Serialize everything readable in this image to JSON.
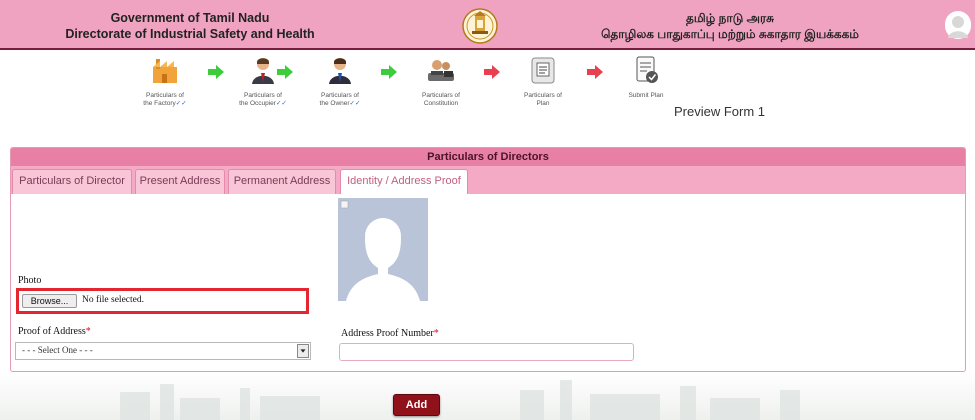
{
  "header": {
    "left_line1": "Government of Tamil Nadu",
    "left_line2": "Directorate of Industrial Safety and Health",
    "right_line1": "தமிழ் நாடு அரசு",
    "right_line2": "தொழிலக பாதுகாப்பு மற்றும் சுகாதார இயக்ககம்",
    "emblem_icon": "tamil-nadu-emblem-icon",
    "avatar_icon": "user-avatar-icon"
  },
  "steps": [
    {
      "line1": "Particulars of",
      "line2": "the Factory",
      "check": "✓✓",
      "icon": "factory-icon"
    },
    {
      "line1": "Particulars of",
      "line2": "the Occupier",
      "check": "✓✓",
      "icon": "occupier-icon"
    },
    {
      "line1": "Particulars of",
      "line2": "the Owner",
      "check": "✓✓",
      "icon": "owner-icon"
    },
    {
      "line1": "Particulars of",
      "line2": "Constitution",
      "check": "",
      "icon": "constitution-icon"
    },
    {
      "line1": "Particulars of",
      "line2": "Plan",
      "check": "",
      "icon": "plan-icon"
    },
    {
      "line1": "Submit Plan",
      "line2": "",
      "check": "",
      "icon": "submit-plan-icon"
    }
  ],
  "preview_label": "Preview Form 1",
  "panel": {
    "title": "Particulars of Directors",
    "tabs": [
      {
        "label": "Particulars of Director",
        "active": false
      },
      {
        "label": "Present Address",
        "active": false
      },
      {
        "label": "Permanent Address",
        "active": false
      },
      {
        "label": "Identity / Address Proof",
        "active": true
      }
    ],
    "photo_label": "Photo",
    "browse_label": "Browse...",
    "no_file_text": "No file selected.",
    "proof_of_address_label": "Proof of Address",
    "proof_select_value": "- - - Select One - - -",
    "address_proof_number_label": "Address Proof Number",
    "required_mark": "*",
    "address_proof_number_value": ""
  },
  "add_button_label": "Add",
  "colors": {
    "header_bg": "#f0a3c1",
    "panel_title_bg": "#e87fa4",
    "tab_bar_bg": "#f4a9c4",
    "add_button": "#8f1119",
    "highlight_box": "#e3262f",
    "done_arrow": "#3ccc3c",
    "pending_arrow": "#e8404f"
  }
}
